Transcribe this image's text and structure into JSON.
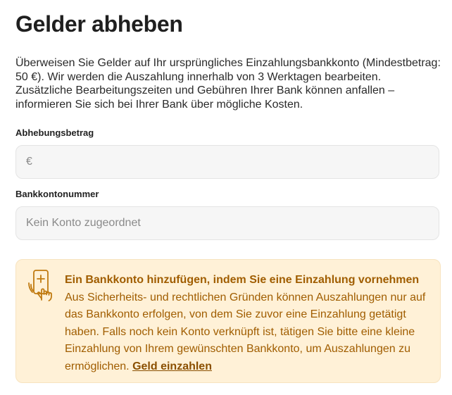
{
  "page": {
    "title": "Gelder abheben",
    "intro": "Überweisen Sie Gelder auf Ihr ursprüngliches Einzahlungsbankkonto (Mindestbetrag: 50 €). Wir werden die Auszahlung innerhalb von 3 Werktagen bearbeiten. Zusätzliche Bearbeitungszeiten und Gebühren Ihrer Bank können anfallen – informieren Sie sich bei Ihrer Bank über mögliche Kosten."
  },
  "form": {
    "amount": {
      "label": "Abhebungsbetrag",
      "placeholder": "€",
      "value": ""
    },
    "account": {
      "label": "Bankkontonummer",
      "placeholder": "Kein Konto zugeordnet",
      "value": ""
    }
  },
  "notice": {
    "title": "Ein Bankkonto hinzufügen, indem Sie eine Einzahlung vornehmen",
    "body": "Aus Sicherheits- und rechtlichen Gründen können Auszahlungen nur auf das Bankkonto erfolgen, von dem Sie zuvor eine Einzahlung getätigt haben. Falls noch kein Konto verknüpft ist, tätigen Sie bitte eine kleine Einzahlung von Ihrem gewünschten Bankkonto, um Auszahlungen zu ermöglichen.",
    "link_label": "Geld einzahlen",
    "icon": "phone-tap-icon"
  },
  "colors": {
    "notice_background": "#fff1d7",
    "notice_text": "#a05d00",
    "input_background": "#f6f6f6"
  }
}
